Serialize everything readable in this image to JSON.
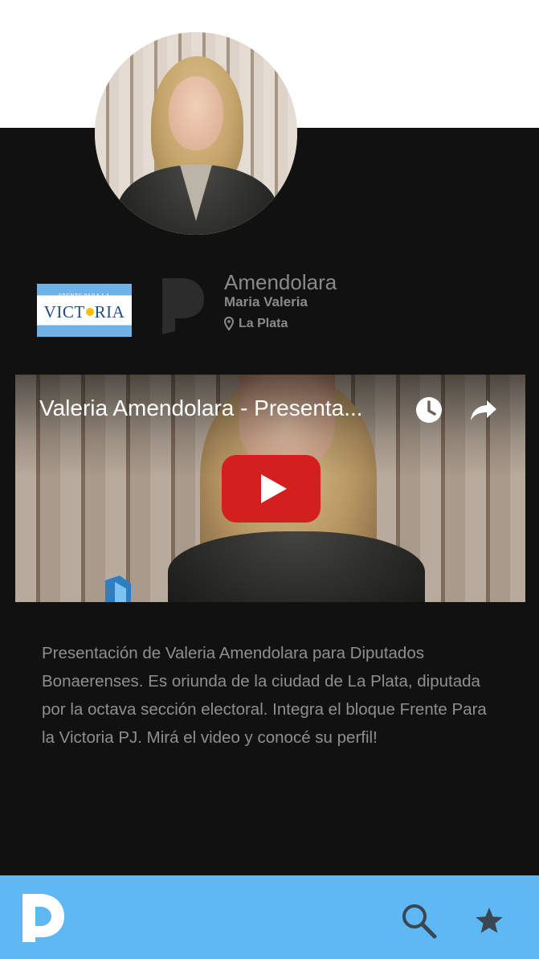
{
  "profile": {
    "surname": "Amendolara",
    "first_names": "Maria Valeria",
    "location": "La Plata",
    "party_logo": {
      "top_text": "FRENTE PARA LA",
      "name_before": "VICT",
      "name_after": "RIA"
    }
  },
  "video": {
    "title": "Valeria Amendolara - Presenta...",
    "icons": [
      "clock-icon",
      "share-icon",
      "play-icon"
    ]
  },
  "description": "Presentación de Valeria Amendolara para Diputados Bonaerenses. Es oriunda de la ciudad de La Plata, diputada por la octava sección electoral. Integra el bloque Frente Para la Victoria PJ. Mirá el video y conocé su perfil!",
  "bottom_bar": {
    "icons": [
      "app-logo",
      "search-icon",
      "star-icon"
    ]
  },
  "colors": {
    "dark_background": "#111111",
    "bottom_bar": "#5eb8f4",
    "text_grey": "#8a8a8a",
    "play_red": "#d31f1f"
  }
}
